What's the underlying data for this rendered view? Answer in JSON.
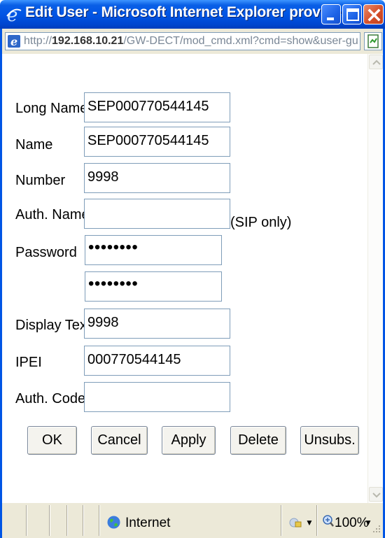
{
  "window": {
    "title": "Edit User - Microsoft Internet Explorer provide..."
  },
  "address": {
    "prefix": "http://",
    "host": "192.168.10.21",
    "path": "/GW-DECT/mod_cmd.xml?cmd=show&user-guid=:"
  },
  "form": {
    "long_name": {
      "label": "Long Name",
      "value": "SEP000770544145"
    },
    "name": {
      "label": "Name",
      "value": "SEP000770544145"
    },
    "number": {
      "label": "Number",
      "value": "9998"
    },
    "auth_name": {
      "label": "Auth. Name",
      "value": "",
      "hint": "(SIP only)"
    },
    "password": {
      "label": "Password",
      "value": "••••••••",
      "confirm_value": "••••••••"
    },
    "display_text": {
      "label": "Display Text",
      "value": "9998"
    },
    "ipei": {
      "label": "IPEI",
      "value": "000770544145"
    },
    "auth_code": {
      "label": "Auth. Code",
      "value": ""
    }
  },
  "buttons": {
    "ok": "OK",
    "cancel": "Cancel",
    "apply": "Apply",
    "delete": "Delete",
    "unsubs": "Unsubs."
  },
  "status": {
    "zone": "Internet",
    "zoom": "100%"
  },
  "colors": {
    "titlebar": "#0055e5",
    "chrome": "#ece9d8",
    "close": "#d5502b"
  }
}
